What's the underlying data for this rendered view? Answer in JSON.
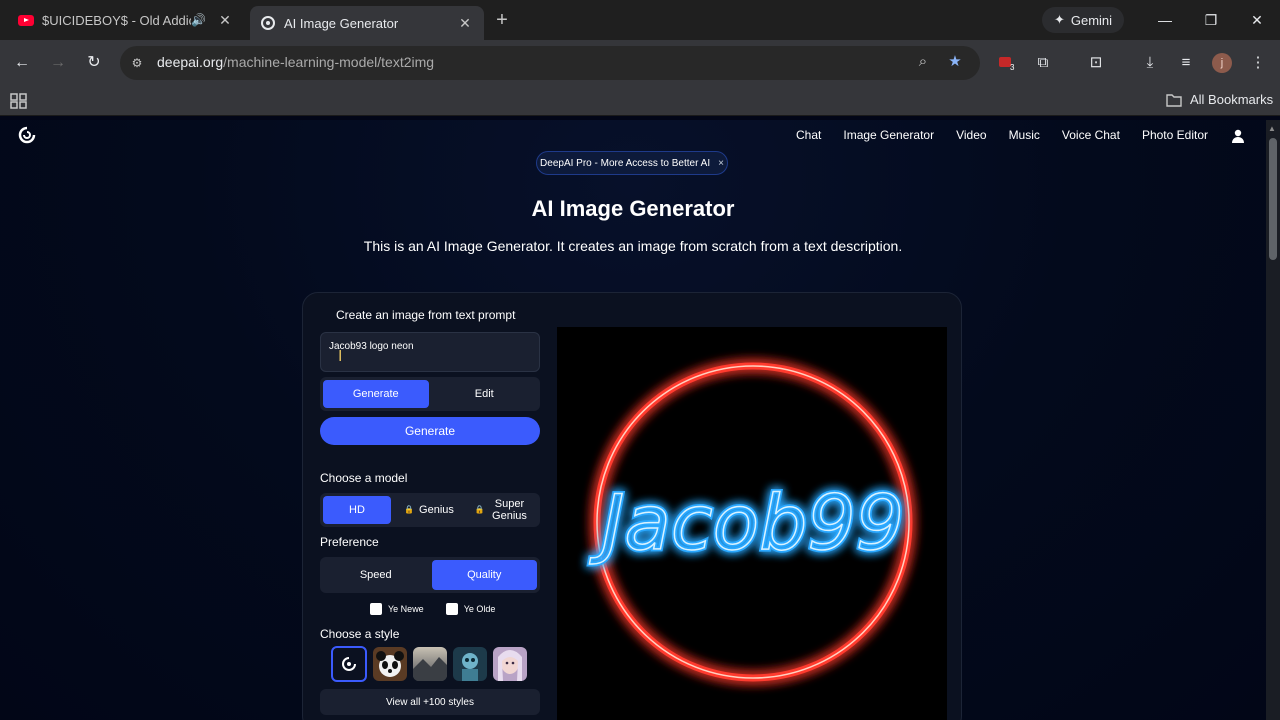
{
  "browser": {
    "tabs": [
      {
        "title": "$UICIDEBOY$ - Old Addicts",
        "active": false,
        "audio": true
      },
      {
        "title": "AI Image Generator",
        "active": true
      }
    ],
    "gemini_label": "Gemini",
    "url_host": "deepai.org",
    "url_path": "/machine-learning-model/text2img",
    "extension_badge": "3",
    "profile_initial": "j",
    "bookmarks_label": "All Bookmarks"
  },
  "site": {
    "nav": [
      "Chat",
      "Image Generator",
      "Video",
      "Music",
      "Voice Chat",
      "Photo Editor"
    ],
    "promo": "DeepAI Pro - More Access to Better AI",
    "promo_close": "×",
    "title": "AI Image Generator",
    "description": "This is an AI Image Generator. It creates an image from scratch from a text description."
  },
  "form": {
    "heading": "Create an image from text prompt",
    "prompt_value": "Jacob93 logo neon",
    "mode_options": [
      "Generate",
      "Edit"
    ],
    "mode_selected": "Generate",
    "generate_button": "Generate",
    "model_label": "Choose a model",
    "models": [
      "HD",
      "Genius",
      "Super Genius"
    ],
    "model_selected": "HD",
    "preference_label": "Preference",
    "preferences": [
      "Speed",
      "Quality"
    ],
    "preference_selected": "Quality",
    "checkboxes": [
      "Ye Newe",
      "Ye Olde"
    ],
    "style_label": "Choose a style",
    "view_all": "View all +100 styles"
  },
  "output": {
    "image_text": "Jacob99"
  },
  "colors": {
    "accent": "#3b5bfd",
    "page_bg": "#020617",
    "neon_ring": "#ff3b2f",
    "neon_text": "#2aa8ff"
  }
}
